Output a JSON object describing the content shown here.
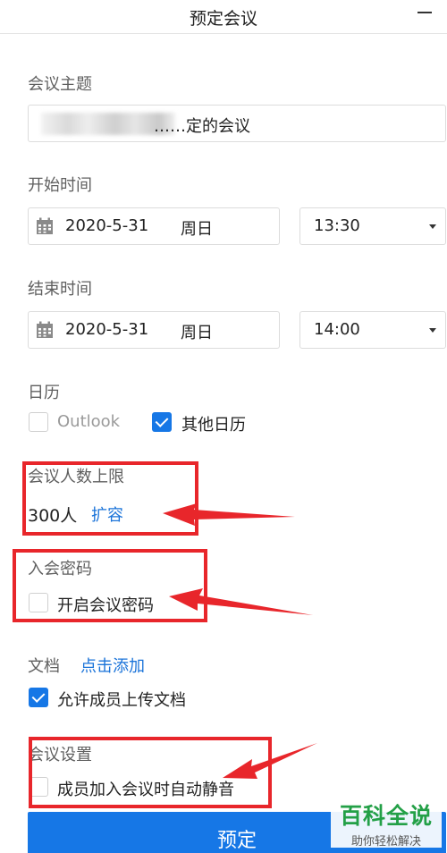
{
  "window": {
    "title": "预定会议"
  },
  "topic": {
    "label": "会议主题",
    "value": "……定的会议"
  },
  "start": {
    "label": "开始时间",
    "date": "2020-5-31",
    "weekday": "周日",
    "time": "13:30"
  },
  "end": {
    "label": "结束时间",
    "date": "2020-5-31",
    "weekday": "周日",
    "time": "14:00"
  },
  "calendar": {
    "label": "日历",
    "outlook": {
      "label": "Outlook",
      "checked": false
    },
    "other": {
      "label": "其他日历",
      "checked": true
    }
  },
  "capacity": {
    "label": "会议人数上限",
    "value": "300人",
    "expand_link": "扩容"
  },
  "password": {
    "label": "入会密码",
    "enable_label": "开启会议密码",
    "checked": false
  },
  "documents": {
    "label": "文档",
    "add_link": "点击添加",
    "allow_upload": {
      "label": "允许成员上传文档",
      "checked": true
    }
  },
  "settings": {
    "label": "会议设置",
    "auto_mute": {
      "label": "成员加入会议时自动静音",
      "checked": false
    }
  },
  "submit": {
    "label": "预定"
  },
  "watermark": {
    "main": "百科全说",
    "sub": "助你轻松解决"
  },
  "colors": {
    "accent": "#1677e6",
    "link": "#1a73d9",
    "annotation": "#e8262b",
    "watermark": "#23a047"
  },
  "icons": {
    "minimize": "minimize-icon",
    "calendar": "calendar-icon",
    "dropdown": "chevron-down-icon",
    "check": "check-icon"
  }
}
